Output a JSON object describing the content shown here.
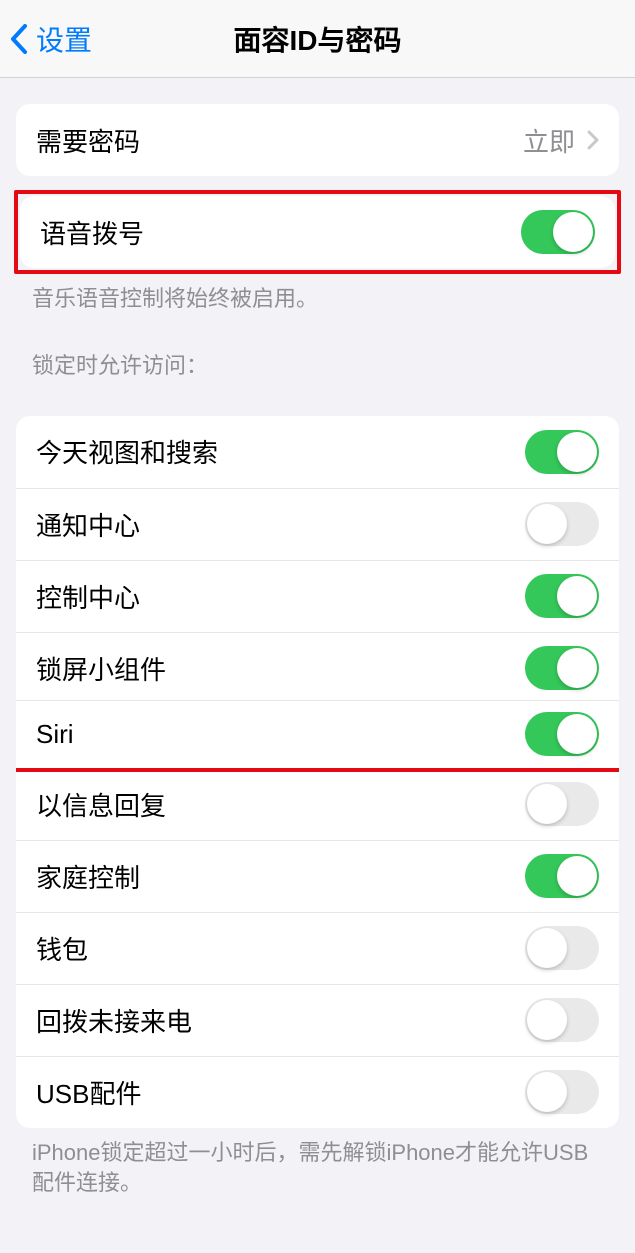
{
  "nav": {
    "back_label": "设置",
    "title": "面容ID与密码"
  },
  "require_passcode": {
    "label": "需要密码",
    "value": "立即"
  },
  "voice_dial": {
    "label": "语音拨号",
    "on": true,
    "footer": "音乐语音控制将始终被启用。"
  },
  "allow_header": "锁定时允许访问：",
  "allow_items": [
    {
      "label": "今天视图和搜索",
      "on": true
    },
    {
      "label": "通知中心",
      "on": false
    },
    {
      "label": "控制中心",
      "on": true
    },
    {
      "label": "锁屏小组件",
      "on": true
    },
    {
      "label": "Siri",
      "on": true,
      "highlight": true
    },
    {
      "label": "以信息回复",
      "on": false
    },
    {
      "label": "家庭控制",
      "on": true
    },
    {
      "label": "钱包",
      "on": false
    },
    {
      "label": "回拨未接来电",
      "on": false
    },
    {
      "label": "USB配件",
      "on": false
    }
  ],
  "allow_footer": "iPhone锁定超过一小时后，需先解锁iPhone才能允许USB配件连接。"
}
